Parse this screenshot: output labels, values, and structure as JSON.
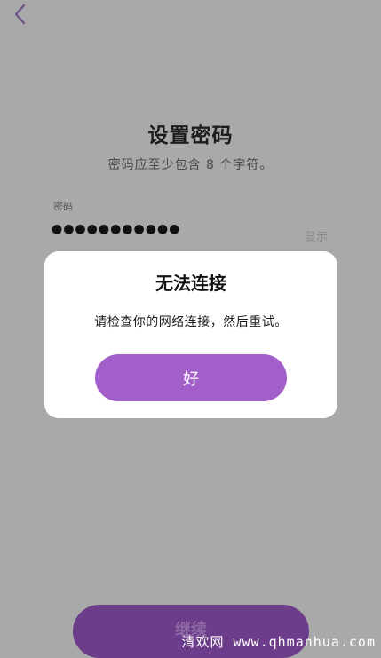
{
  "nav": {
    "back_icon": "chevron-left-icon"
  },
  "header": {
    "title": "设置密码",
    "subtitle": "密码应至少包含 8 个字符。"
  },
  "password_field": {
    "label": "密码",
    "value": "●●●●●●●●●●●",
    "show_toggle": "显示"
  },
  "dialog": {
    "title": "无法连接",
    "message": "请检查你的网络连接，然后重试。",
    "ok_label": "好"
  },
  "footer": {
    "continue_label": "继续"
  },
  "watermark": "清欢网 www.qhmanhua.com",
  "colors": {
    "accent": "#a25fc9",
    "overlay_background": "#a9a9a9",
    "continue_button": "#6c3d8a"
  }
}
